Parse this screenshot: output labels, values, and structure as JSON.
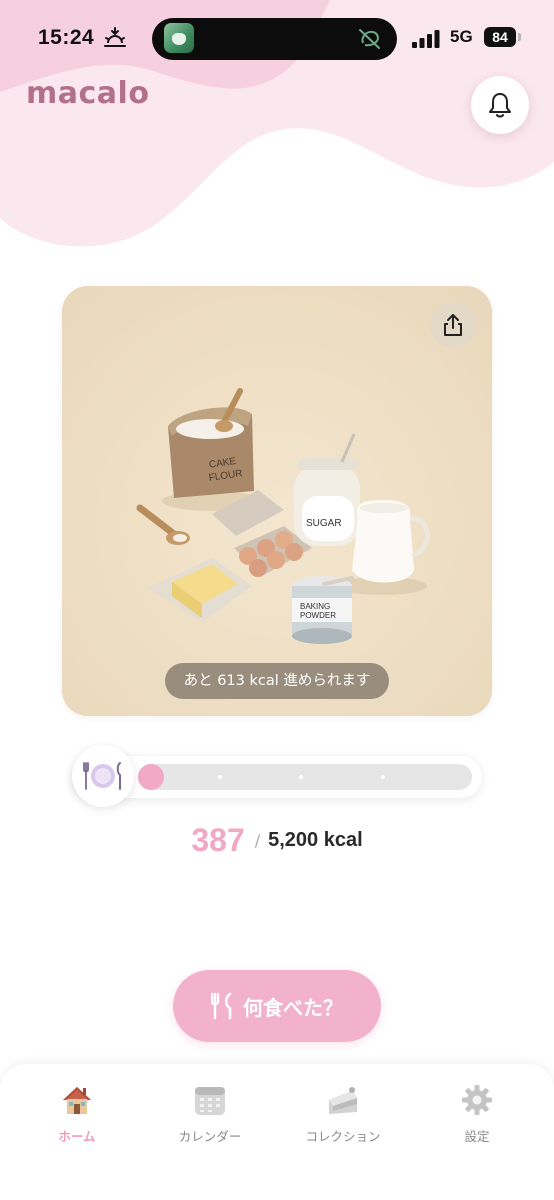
{
  "status_bar": {
    "time": "15:24",
    "network": "5G",
    "battery": "84"
  },
  "header": {
    "logo": "macalo",
    "bell_icon": "bell-icon"
  },
  "hero": {
    "share_icon": "share-icon",
    "remaining_text": "あと 613 kcal 進められます",
    "image_labels": {
      "flour_bag": "CAKE\nFLOUR",
      "sugar_jar": "SUGAR",
      "baking_powder": "BAKING\nPOWDER"
    }
  },
  "progress": {
    "plate_icon": "plate-cutlery-icon",
    "fraction": 0.0744,
    "current": "387",
    "separator": "/",
    "goal": "5,200 kcal"
  },
  "actions": {
    "eat_label": "何食べた？",
    "eat_icon": "fork-knife-icon"
  },
  "nav": {
    "items": [
      {
        "label": "ホーム",
        "icon": "house-icon",
        "active": true
      },
      {
        "label": "カレンダー",
        "icon": "calendar-icon",
        "active": false
      },
      {
        "label": "コレクション",
        "icon": "cake-icon",
        "active": false
      },
      {
        "label": "設定",
        "icon": "gear-icon",
        "active": false
      }
    ]
  },
  "colors": {
    "accent": "#f2b2cc",
    "accent_text": "#f0a8c4",
    "logo": "#b2708a",
    "header_pink": "#f9dce7"
  }
}
